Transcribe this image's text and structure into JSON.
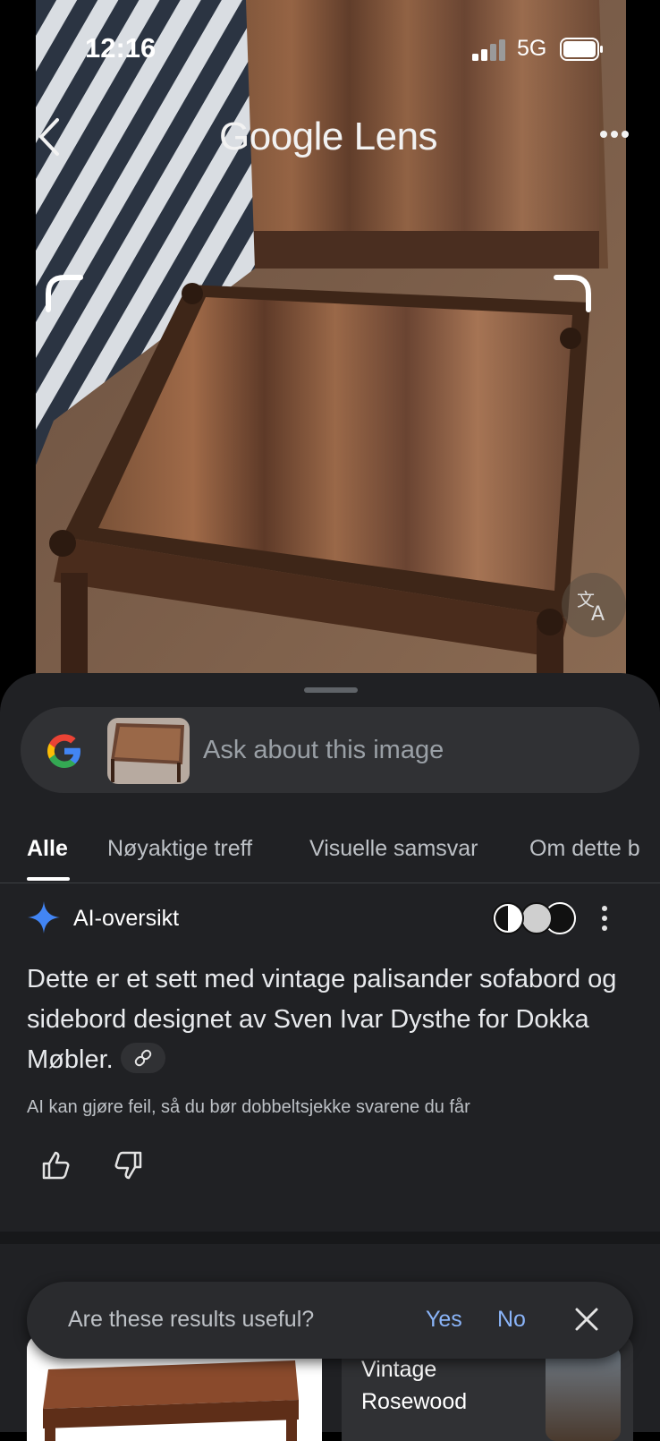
{
  "status_bar": {
    "time": "12:16",
    "network": "5G"
  },
  "header": {
    "title_google": "Google",
    "title_lens": "Lens"
  },
  "search": {
    "placeholder": "Ask about this image"
  },
  "tabs": [
    {
      "label": "Alle",
      "active": true
    },
    {
      "label": "Nøyaktige treff",
      "active": false
    },
    {
      "label": "Visuelle samsvar",
      "active": false
    },
    {
      "label": "Om dette b",
      "active": false
    }
  ],
  "ai_overview": {
    "title": "AI-oversikt",
    "answer": "Dette er et sett med vintage palisander sofabord og sidebord designet av Sven Ivar Dysthe for Dokka Møbler.",
    "disclaimer": "AI kan gjøre feil, så du bør dobbeltsjekke svarene du får"
  },
  "feedback": {
    "question": "Are these results useful?",
    "yes": "Yes",
    "no": "No"
  },
  "results": [
    {
      "title": ""
    },
    {
      "title": "Vintage Rosewood"
    }
  ],
  "colors": {
    "sheet_bg": "#202124",
    "link_blue": "#8ab4f8",
    "accent_spark": "#4285f4"
  }
}
